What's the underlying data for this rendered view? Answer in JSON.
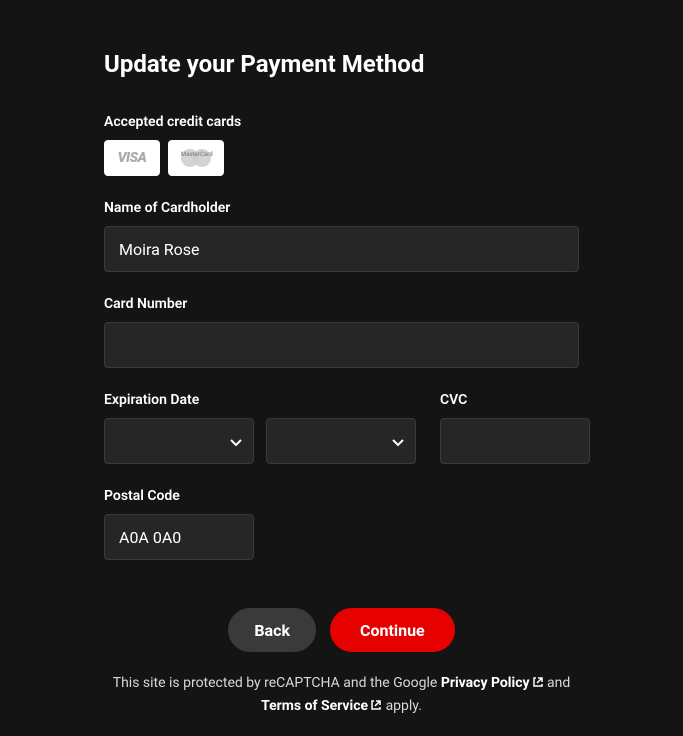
{
  "title": "Update your Payment Method",
  "accepted": {
    "label": "Accepted credit cards",
    "visa": "VISA",
    "mastercard": "MasterCard"
  },
  "fields": {
    "name": {
      "label": "Name of Cardholder",
      "value": "Moira Rose"
    },
    "cardNumber": {
      "label": "Card Number",
      "value": ""
    },
    "expiration": {
      "label": "Expiration Date"
    },
    "cvc": {
      "label": "CVC",
      "value": ""
    },
    "postal": {
      "label": "Postal Code",
      "value": "A0A 0A0"
    }
  },
  "buttons": {
    "back": "Back",
    "continue": "Continue"
  },
  "legal": {
    "prefix": "This site is protected by reCAPTCHA and the Google ",
    "privacy": "Privacy Policy",
    "and": " and ",
    "terms": "Terms of Service",
    "suffix": " apply."
  }
}
